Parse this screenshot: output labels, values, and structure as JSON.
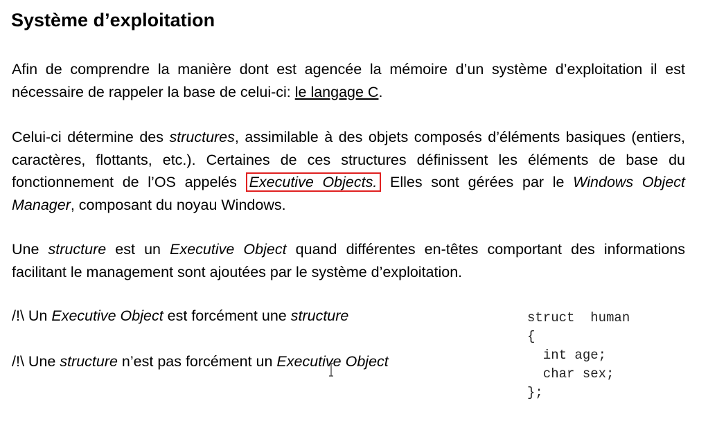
{
  "title": "Système d’exploitation",
  "p1": {
    "text_before": "Afin de comprendre la manière dont est agencée la mémoire d’un système d’exploitation il est nécessaire de rappeler la base de celui-ci: ",
    "link": "le langage C",
    "text_after": "."
  },
  "p2": {
    "t1": "Celui-ci détermine des ",
    "em1": "structures",
    "t2": ", assimilable à des objets composés d’éléments basiques (entiers, caractères, flottants, etc.). Certaines de ces structures définissent les éléments de base du fonctionnement de l’OS appelés ",
    "highlight": "Executive Objects.",
    "t3": " Elles sont gérées par le ",
    "em2": "Windows Object Manager",
    "t4": ", composant du noyau Windows."
  },
  "p3": {
    "t1": "Une ",
    "em1": "structure",
    "t2": " est un ",
    "em2": "Executive Object",
    "t3": " quand différentes en-têtes comportant des informations facilitant le management sont ajoutées par le système d’exploitation."
  },
  "note1": {
    "prefix": "/!\\ Un ",
    "em1": "Executive Object",
    "mid": " est forcément une ",
    "em2": "structure"
  },
  "note2": {
    "prefix": "/!\\ Une ",
    "em1": "structure",
    "mid": " n’est pas forcément un ",
    "em2": "Executive Object"
  },
  "code": {
    "lines": [
      "struct  human",
      "{",
      "  int age;",
      "  char sex;",
      "};"
    ]
  },
  "colors": {
    "highlight_border": "#e02020"
  }
}
